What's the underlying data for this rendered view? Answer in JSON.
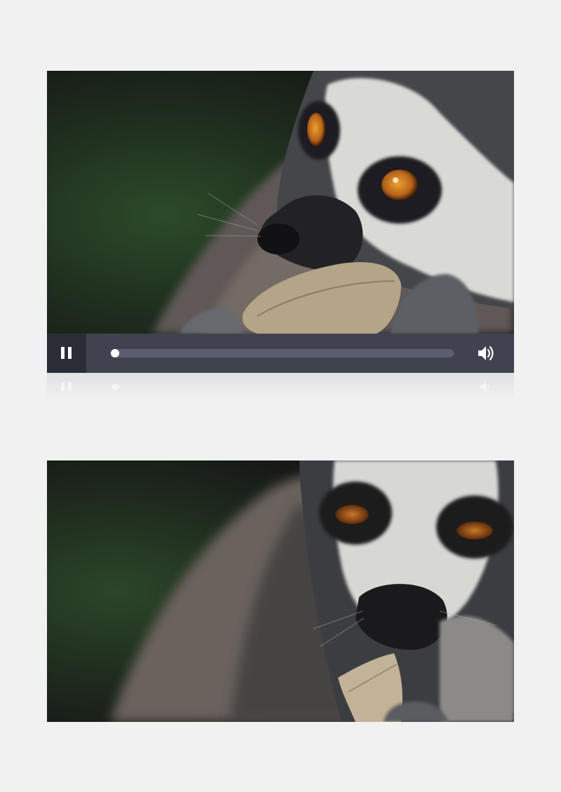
{
  "player": {
    "state": "playing",
    "progress": 0.0,
    "controls": {
      "pause_icon": "pause-icon",
      "volume_icon": "speaker-volume-icon"
    }
  },
  "frames": [
    {
      "subject": "lemur-eating-leaf-side-view"
    },
    {
      "subject": "lemur-eating-leaf-front-view"
    }
  ],
  "colors": {
    "page_background": "#f1f1f2",
    "control_bar": "#40434f",
    "play_button_bg": "#2b2d36",
    "track": "#5a5e70",
    "thumb": "#ffffff"
  }
}
